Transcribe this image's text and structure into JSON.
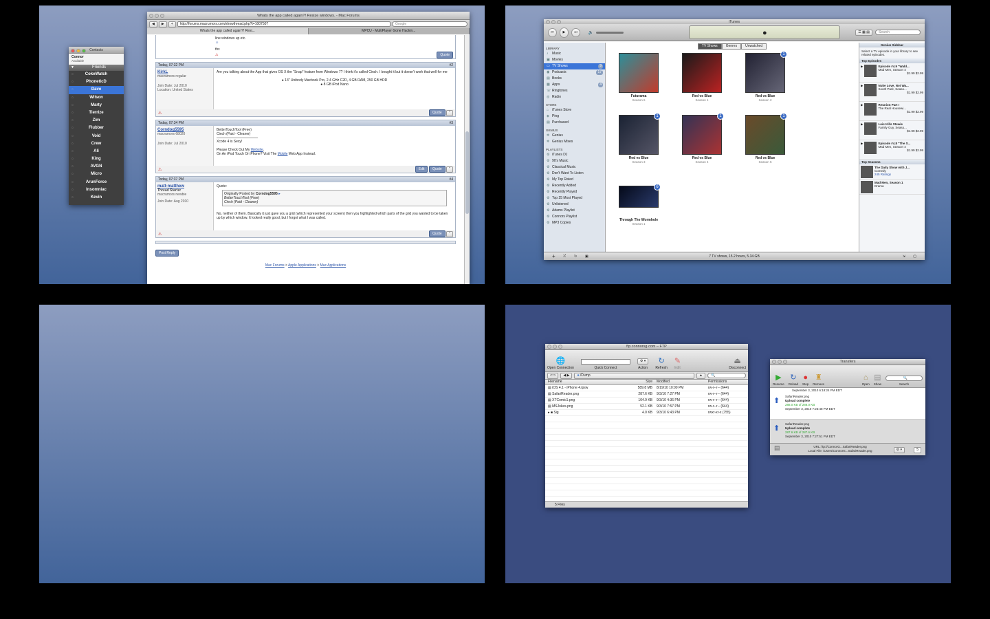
{
  "contacts": {
    "title": "Contacts",
    "me_name": "Connor",
    "me_status": "Available",
    "group": "Friends",
    "items": [
      "CokeWatch",
      "PhoneticD",
      "Dave",
      "Wilson",
      "Marty",
      "Tierrize",
      "Zim",
      "Flubber",
      "Void",
      "Crew",
      "Ali",
      "King",
      "AVGN",
      "Micro",
      "ArunForce",
      "Insomniac",
      "Kevin"
    ],
    "selected": "Dave"
  },
  "browser": {
    "title": "Whats the app called again?! Resize windows. - Mac Forums",
    "url": "http://forums.macrumors.com/showthread.php?t=1007507",
    "search_placeholder": "Google",
    "tabs": [
      "Whats the app called again?! Resi...",
      "MPCU - MultiPlayer Gone Hackin..."
    ],
    "top_text": "line windows up etc.",
    "top_text2": "thx",
    "posts": [
      {
        "date": "Today, 07:32 PM",
        "num": "#2",
        "user": "KirkL",
        "role": "macrumors regular",
        "join": "Join Date: Jul 2010",
        "loc": "Location: United States",
        "body": "Are you talking about the App that gives OS X the \"Snap\" feature from Windows 7? I think it's called Cinch. I bought it but it doesn't work that well for me",
        "spec1": "13\" Unibody Macbook Pro, 2.4 GHz C2D, 4 GB RAM, 250 GB HDD",
        "spec2": "8 GB iPod Nano"
      },
      {
        "date": "Today, 07:34 PM",
        "num": "#3",
        "user": "Corndog5595",
        "role": "macrumors 68020",
        "join": "Join Date: Jul 2010",
        "l1": "BetterTouchTool (Free)",
        "l2": "Cinch (Paid - Cleaner)",
        "l3": "Xcode 4 is Sexy!",
        "l4a": "Please Check Out My ",
        "l4b": "Website",
        "l5a": "On An iPod Touch Or iPhone? Visit The ",
        "l5b": "Mobile",
        "l5c": " Web App Instead."
      },
      {
        "date": "Today, 07:37 PM",
        "num": "#4",
        "user": "matt-matthew",
        "role": "Thread Starter",
        "role2": "macrumors newbie",
        "join": "Join Date: Aug 2010",
        "quote_label": "Quote:",
        "qa": "Originally Posted by ",
        "qb": "Corndog5595",
        "q1": "BetterTouchTool (Free)",
        "q2": "Cinch (Paid - Cleaner)",
        "body": "No, neither of them. Basically it just gave you a grid (which represented your screen) then you highlighted which parts of the grid you wanted to be taken up by which window. It looked really good, but I forgot what I was called."
      }
    ],
    "quote_btn": "Quote",
    "edit_btn": "Edit",
    "post_reply": "Post Reply",
    "breadcrumb": [
      "Mac Forums",
      "Apple Applications",
      "Mac Applications"
    ]
  },
  "itunes": {
    "title": "iTunes",
    "search_placeholder": "Search",
    "sections": [
      {
        "h": "LIBRARY",
        "items": [
          "Music",
          "Movies",
          "TV Shows",
          "Podcasts",
          "Books",
          "Apps",
          "Ringtones",
          "Radio"
        ]
      },
      {
        "h": "STORE",
        "items": [
          "iTunes Store",
          "Ping",
          "Purchased"
        ]
      },
      {
        "h": "GENIUS",
        "items": [
          "Genius",
          "Genius Mixes"
        ]
      },
      {
        "h": "PLAYLISTS",
        "items": [
          "iTunes DJ",
          "90's Music",
          "Classical Music",
          "Don't Want To Listen",
          "My Top Rated",
          "Recently Added",
          "Recently Played",
          "Top 25 Most Played",
          "Unlistened",
          "Adams Playlist",
          "Connors Playlist",
          "MP3 Copies"
        ]
      }
    ],
    "selected": "TV Shows",
    "counts": {
      "TV Shows": "9",
      "Podcasts": "17",
      "Apps": "4"
    },
    "view_tabs": [
      "TV Shows",
      "Genres",
      "Unwatched"
    ],
    "shows": [
      {
        "title": "Futurama",
        "sub": "Season 6",
        "badge": "",
        "c1": "#2c8f9a",
        "c2": "#c23b2b"
      },
      {
        "title": "Red vs Blue",
        "sub": "Season 1",
        "badge": "",
        "c1": "#1a1a1a",
        "c2": "#b22"
      },
      {
        "title": "Red vs Blue",
        "sub": "Season 2",
        "badge": "1",
        "c1": "#223",
        "c2": "#667"
      },
      {
        "title": "Red vs Blue",
        "sub": "Season 3",
        "badge": "1",
        "c1": "#1a2233",
        "c2": "#556"
      },
      {
        "title": "Red vs Blue",
        "sub": "Season 4",
        "badge": "1",
        "c1": "#335",
        "c2": "#a33"
      },
      {
        "title": "Red vs Blue",
        "sub": "Season 5",
        "badge": "1",
        "c1": "#6a4a2a",
        "c2": "#3a5a3a"
      },
      {
        "title": "Through The Wormhole",
        "sub": "Season 1",
        "badge": "6",
        "c1": "#050a1a",
        "c2": "#2a3a6a"
      }
    ],
    "genius": {
      "header": "Genius Sidebar",
      "intro": "Select a TV episode in your library to see related episodes.",
      "top_eps": "Top Episodes",
      "eps": [
        {
          "t": "Episode #4.9 \"Wald...",
          "s": "Mad Men, Season 4",
          "price": "$1.99",
          "price2": "$2.99"
        },
        {
          "t": "Nuke Love, Not Wa...",
          "s": "South Park, Seaso...",
          "price": "$1.99",
          "price2": "$2.99"
        },
        {
          "t": "Reunion Part I",
          "s": "The Real Housewi...",
          "price": "$1.99",
          "price2": "$2.99"
        },
        {
          "t": "Lois Kills Stewie",
          "s": "Family Guy, Seaso...",
          "price": "$1.99",
          "price2": "$2.99"
        },
        {
          "t": "Episode #4.8 \"The S...",
          "s": "Mad Men, Season 4",
          "price": "$1.99",
          "price2": "$2.99"
        }
      ],
      "top_seasons": "Top Seasons",
      "seasons": [
        {
          "t": "The Daily Show with J...",
          "s": "Comedy",
          "ratings": "245 Ratings"
        },
        {
          "t": "Mad Men, Season 1",
          "s": "Drama"
        }
      ]
    },
    "status": "7 TV shows, 15.2 hours, 5.34 GB"
  },
  "ftp": {
    "title": "ftp.connorsg.com – FTP",
    "tools": {
      "open": "Open Connection",
      "quick": "Quick Connect",
      "action": "Action",
      "refresh": "Refresh",
      "edit": "Edit",
      "disconnect": "Disconnect"
    },
    "path": "/Dump",
    "cols": [
      "Filename",
      "Size",
      "Modified",
      "Permissions"
    ],
    "files": [
      {
        "name": "iOS 4.1 - iPhone 4.ipsw",
        "size": "589.8 MB",
        "mod": "8/19/10 10:00 PM",
        "perm": "rw-r--r-- (644)"
      },
      {
        "name": "SafariReader.png",
        "size": "287.6 KB",
        "mod": "9/3/10 7:27 PM",
        "perm": "rw-r--r-- (644)"
      },
      {
        "name": "XTComic1.png",
        "size": "104.9 KB",
        "mod": "9/3/10 4:36 PM",
        "perm": "rw-r--r-- (644)"
      },
      {
        "name": "MSJokes.png",
        "size": "52.1 KB",
        "mod": "9/3/10 7:57 PM",
        "perm": "rw-r--r-- (644)"
      },
      {
        "name": "Sig",
        "size": "4.0 KB",
        "mod": "9/3/10 6:43 PM",
        "perm": "rwxr-xr-x (755)"
      }
    ],
    "status": "5 Files"
  },
  "transfers": {
    "title": "Transfers",
    "tools": [
      "Resume",
      "Reload",
      "Stop",
      "Remove",
      "Open",
      "Show",
      "Search"
    ],
    "items": [
      {
        "file": "SafariReader.png",
        "state": "Upload complete",
        "size": "288.0 KB of 288.0 KB",
        "date": "September 3, 2010 7:25:48 PM EDT",
        "top": "September 3, 2010 6:18:24 PM EDT"
      },
      {
        "file": "SafariReader.png",
        "state": "Upload complete",
        "size": "287.6 KB of 287.6 KB",
        "date": "September 3, 2010 7:27:51 PM EDT"
      }
    ],
    "url": "URL: ftp://ConnorG...SafariReader.png",
    "local": "Local File: /Users/ConnorG...SafariReader.png",
    "count": "5"
  }
}
